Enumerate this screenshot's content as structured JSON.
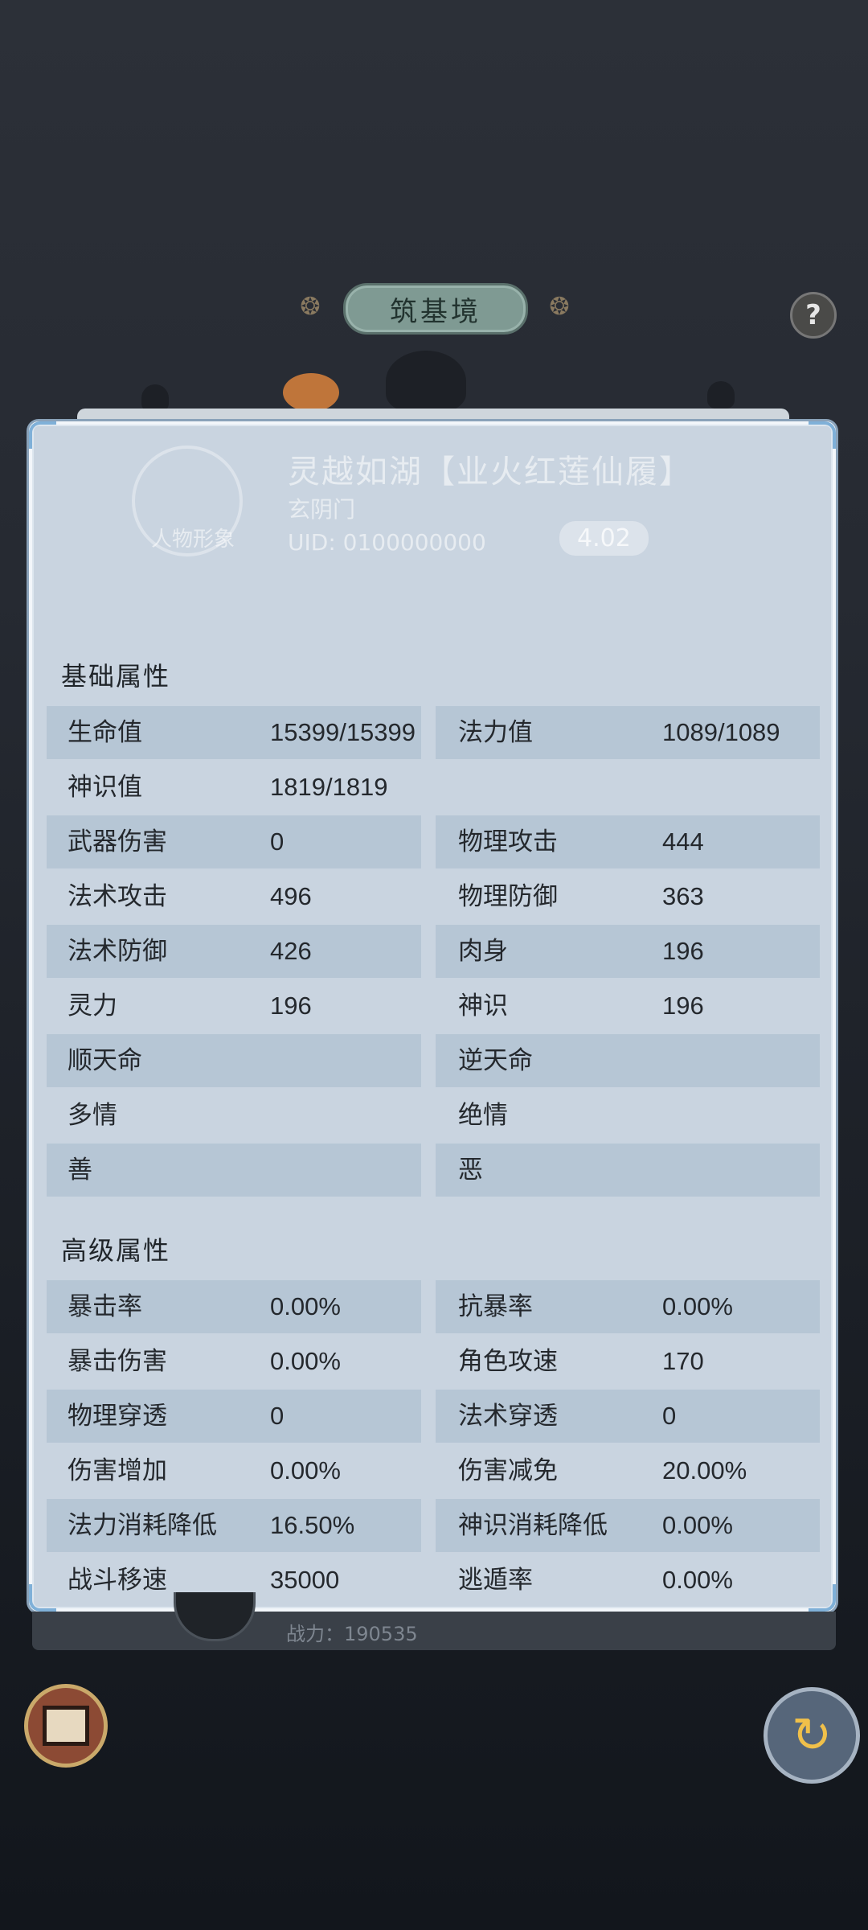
{
  "header": {
    "realm_title": "筑基境",
    "help_label": "?"
  },
  "background_profile": {
    "name": "灵越如湖【业火红莲仙履】",
    "sect": "玄阴门",
    "uid": "UID: 0100000000",
    "power_badge": "4.02",
    "avatar_label": "人物形象"
  },
  "panel": {
    "basic_title": "基础属性",
    "advanced_title": "高级属性",
    "basic_rows": [
      {
        "l_label": "生命值",
        "l_value": "15399/15399",
        "r_label": "法力值",
        "r_value": "1089/1089"
      },
      {
        "l_label": "神识值",
        "l_value": "1819/1819",
        "r_label": "",
        "r_value": ""
      },
      {
        "l_label": "武器伤害",
        "l_value": "0",
        "r_label": "物理攻击",
        "r_value": "444"
      },
      {
        "l_label": "法术攻击",
        "l_value": "496",
        "r_label": "物理防御",
        "r_value": "363"
      },
      {
        "l_label": "法术防御",
        "l_value": "426",
        "r_label": "肉身",
        "r_value": "196"
      },
      {
        "l_label": "灵力",
        "l_value": "196",
        "r_label": "神识",
        "r_value": "196"
      },
      {
        "l_label": "顺天命",
        "l_value": "",
        "r_label": "逆天命",
        "r_value": ""
      },
      {
        "l_label": "多情",
        "l_value": "",
        "r_label": "绝情",
        "r_value": ""
      },
      {
        "l_label": "善",
        "l_value": "",
        "r_label": "恶",
        "r_value": ""
      }
    ],
    "advanced_rows": [
      {
        "l_label": "暴击率",
        "l_value": "0.00%",
        "r_label": "抗暴率",
        "r_value": "0.00%"
      },
      {
        "l_label": "暴击伤害",
        "l_value": "0.00%",
        "r_label": "角色攻速",
        "r_value": "170"
      },
      {
        "l_label": "物理穿透",
        "l_value": "0",
        "r_label": "法术穿透",
        "r_value": "0"
      },
      {
        "l_label": "伤害增加",
        "l_value": "0.00%",
        "r_label": "伤害减免",
        "r_value": "20.00%"
      },
      {
        "l_label": "法力消耗降低",
        "l_value": "16.50%",
        "r_label": "神识消耗降低",
        "r_value": "0.00%"
      },
      {
        "l_label": "战斗移速",
        "l_value": "35000",
        "r_label": "逃遁率",
        "r_value": "0.00%"
      }
    ]
  },
  "footer": {
    "power_text": "战力：190535"
  },
  "icons": {
    "left_button": "gate-icon",
    "right_button": "swirl-icon",
    "ornaments": "cloud-ornament-icon"
  }
}
